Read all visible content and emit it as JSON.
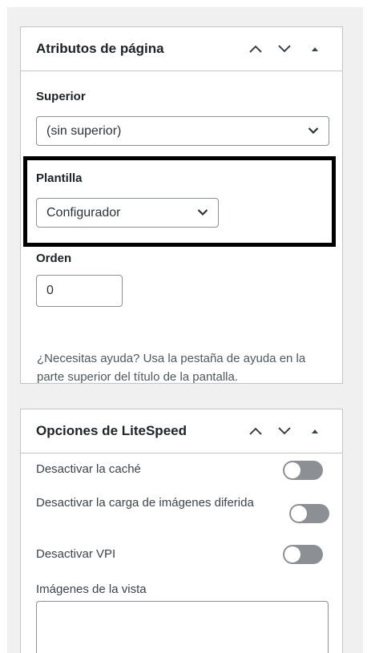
{
  "page_attributes": {
    "title": "Atributos de página",
    "parent_label": "Superior",
    "parent_value": "(sin superior)",
    "template_label": "Plantilla",
    "template_value": "Configurador",
    "order_label": "Orden",
    "order_value": "0",
    "help_text": "¿Necesitas ayuda? Usa la pestaña de ayuda en la parte superior del título de la pantalla."
  },
  "litespeed": {
    "title": "Opciones de LiteSpeed",
    "options": [
      {
        "label": "Desactivar la caché",
        "enabled": false
      },
      {
        "label": "Desactivar la carga de imágenes diferida",
        "enabled": false
      },
      {
        "label": "Desactivar VPI",
        "enabled": false
      }
    ],
    "viewport_images_label": "Imágenes de la vista",
    "viewport_images_value": ""
  },
  "icons": {
    "move_up": "chevron-up-icon",
    "move_down": "chevron-down-icon",
    "toggle_panel": "triangle-up-icon",
    "select_arrow": "chevron-down-icon"
  },
  "colors": {
    "border": "#c3c4c7",
    "toggle_off": "#8c8f94",
    "highlight": "#000000"
  }
}
